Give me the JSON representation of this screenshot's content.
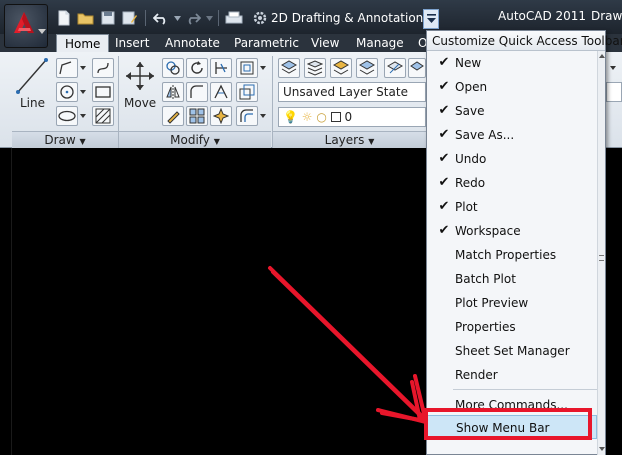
{
  "window": {
    "workspace_name": "2D Drafting & Annotation",
    "title": "AutoCAD 2011",
    "title_suffix": "Drawi"
  },
  "tabs": [
    {
      "label": "Home",
      "active": true
    },
    {
      "label": "Insert"
    },
    {
      "label": "Annotate"
    },
    {
      "label": "Parametric"
    },
    {
      "label": "View"
    },
    {
      "label": "Manage"
    },
    {
      "label": "O"
    }
  ],
  "ribbon": {
    "draw": {
      "title": "Draw",
      "line_label": "Line"
    },
    "modify": {
      "title": "Modify",
      "move_label": "Move"
    },
    "layers": {
      "title": "Layers",
      "layer_state": "Unsaved Layer State",
      "current_layer": "0"
    }
  },
  "menu": {
    "title": "Customize Quick Access Toolbar",
    "items": [
      {
        "label": "New",
        "checked": true
      },
      {
        "label": "Open",
        "checked": true
      },
      {
        "label": "Save",
        "checked": true
      },
      {
        "label": "Save As...",
        "checked": true
      },
      {
        "label": "Undo",
        "checked": true
      },
      {
        "label": "Redo",
        "checked": true
      },
      {
        "label": "Plot",
        "checked": true
      },
      {
        "label": "Workspace",
        "checked": true
      },
      {
        "label": "Match Properties",
        "checked": false
      },
      {
        "label": "Batch Plot",
        "checked": false
      },
      {
        "label": "Plot Preview",
        "checked": false
      },
      {
        "label": "Properties",
        "checked": false
      },
      {
        "label": "Sheet Set Manager",
        "checked": false
      },
      {
        "label": "Render",
        "checked": false
      }
    ],
    "more_commands": "More Commands...",
    "show_menu_bar": "Show Menu Bar"
  },
  "colors": {
    "annotation": "#e8162b",
    "menu_highlight": "#cde6f7"
  }
}
